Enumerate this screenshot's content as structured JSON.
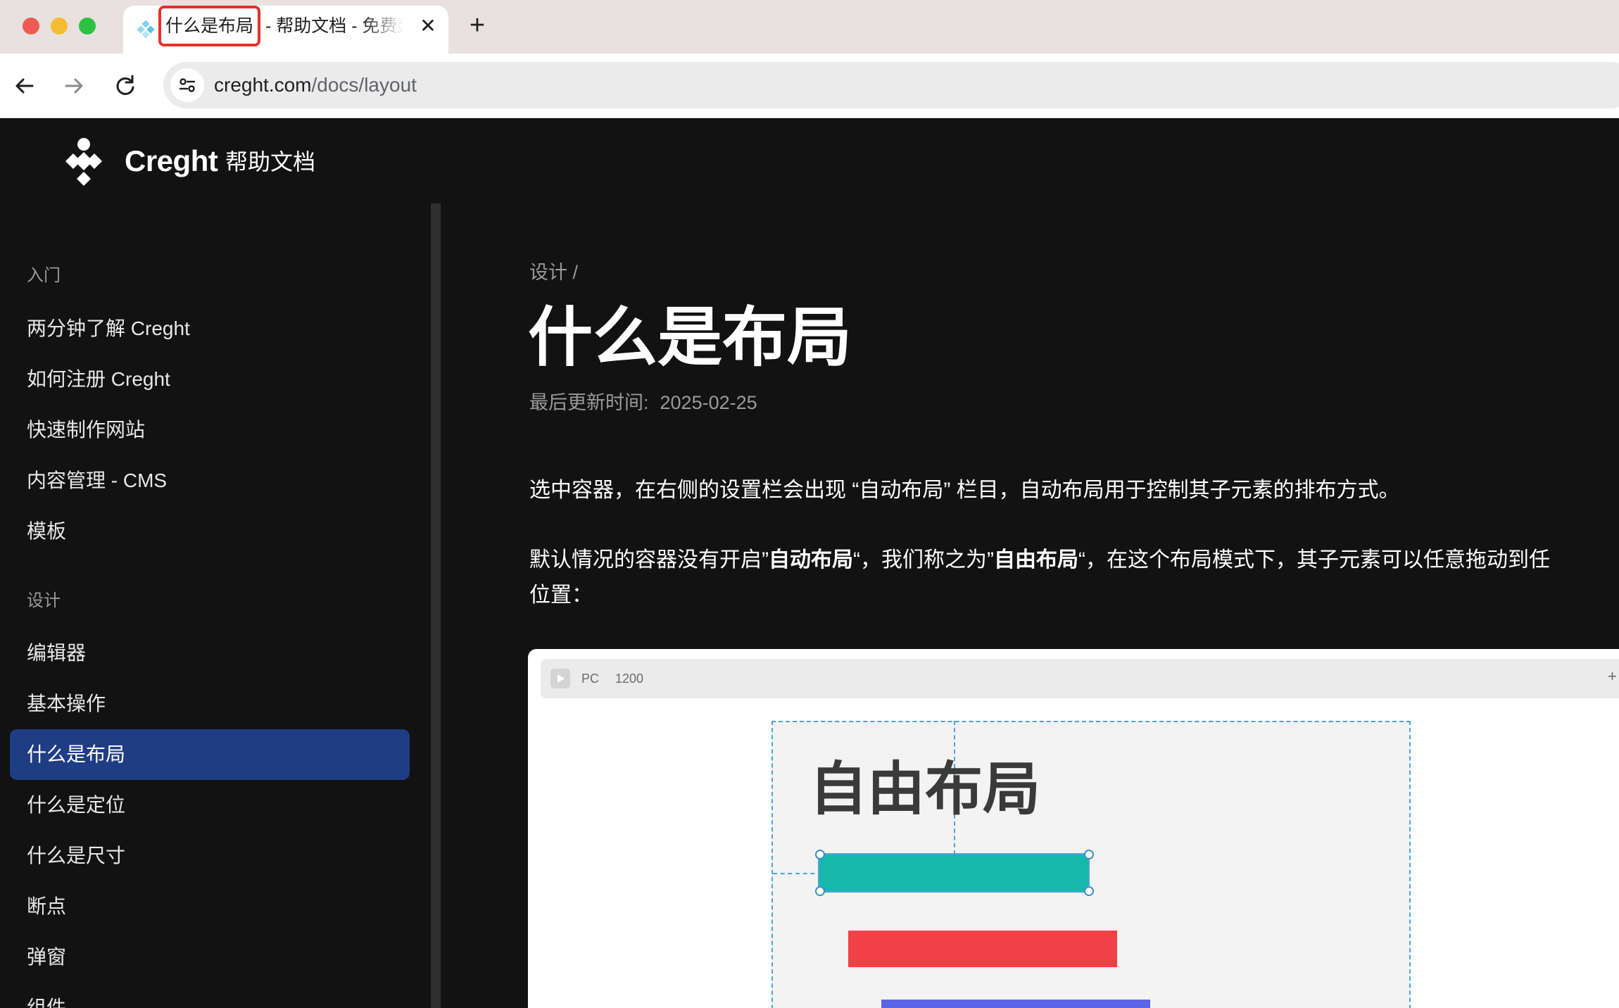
{
  "browser": {
    "tab": {
      "title_highlight": "什么是布局",
      "title_rest": "- 帮助文档 - 免费建",
      "close_icon": "✕"
    },
    "new_tab_icon": "+",
    "url_host": "creght.com",
    "url_path": "/docs/layout"
  },
  "site": {
    "brand": "Creght",
    "brand_sub": "帮助文档"
  },
  "sidebar": {
    "sections": [
      {
        "title": "入门",
        "items": [
          "两分钟了解 Creght",
          "如何注册 Creght",
          "快速制作网站",
          "内容管理 - CMS",
          "模板"
        ]
      },
      {
        "title": "设计",
        "items": [
          "编辑器",
          "基本操作",
          "什么是布局",
          "什么是定位",
          "什么是尺寸",
          "断点",
          "弹窗",
          "组件"
        ]
      }
    ],
    "active_item": "什么是布局"
  },
  "main": {
    "breadcrumb": "设计 /",
    "title": "什么是布局",
    "updated_label": "最后更新时间:",
    "updated_date": "2025-02-25",
    "para1": "选中容器，在右侧的设置栏会出现 “自动布局” 栏目，自动布局用于控制其子元素的排布方式。",
    "para2": {
      "t1": "默认情况的容器没有开启”",
      "b1": "自动布局",
      "t2": "“，我们称之为”",
      "b2": "自由布局",
      "t3": "“，在这个布局模式下，其子元素可以任意拖动到任",
      "line2": "位置："
    },
    "figure": {
      "device_label": "PC",
      "width_label": "1200",
      "heading": "自由布局",
      "edge_icon": "+",
      "colors": {
        "teal": "#15b8aa",
        "red": "#f04146",
        "purple": "#5b63e6",
        "guide": "#4ea3d9"
      }
    }
  }
}
